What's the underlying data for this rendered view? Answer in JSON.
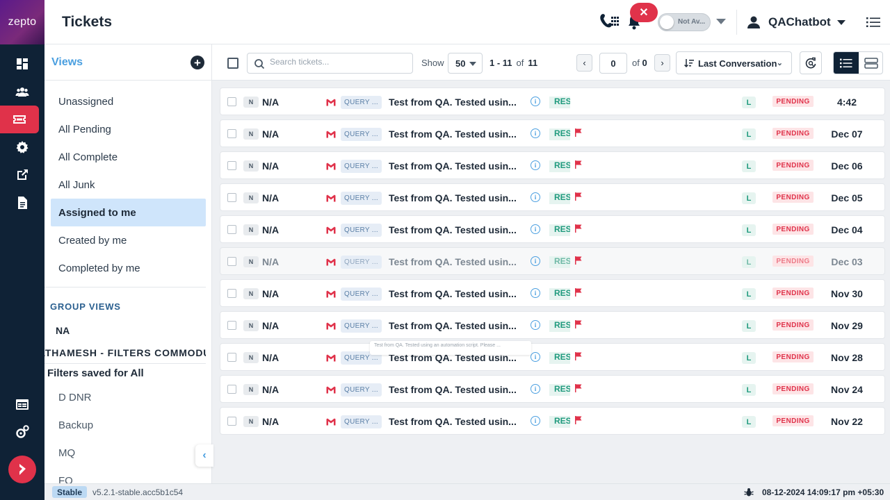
{
  "brand": {
    "logo_text": "zepto"
  },
  "rail": {
    "items": [
      {
        "name": "dashboard-icon"
      },
      {
        "name": "users-icon"
      },
      {
        "name": "tickets-icon",
        "active": true
      },
      {
        "name": "settings-icon"
      },
      {
        "name": "external-link-icon"
      },
      {
        "name": "document-icon"
      }
    ],
    "bottom_items": [
      {
        "name": "calendar-icon"
      },
      {
        "name": "config-icon"
      }
    ]
  },
  "header": {
    "title": "Tickets",
    "availability": "Not Av...",
    "user_name": "QAChatbot",
    "close_label": "✕"
  },
  "views": {
    "title": "Views",
    "items": [
      {
        "label": "Unassigned",
        "active": false
      },
      {
        "label": "All Pending",
        "active": false
      },
      {
        "label": "All Complete",
        "active": false
      },
      {
        "label": "All Junk",
        "active": false
      },
      {
        "label": "Assigned to me",
        "active": true
      },
      {
        "label": "Created by me",
        "active": false
      },
      {
        "label": "Completed by me",
        "active": false
      }
    ],
    "group_views_title": "GROUP VIEWS",
    "group_na": "NA",
    "group_filter": "PRATHAMESH - FILTERS COMMODUI",
    "filters_saved_title": "Filters saved for All",
    "filters_saved": [
      "D DNR",
      "Backup",
      "MQ",
      "FQ"
    ]
  },
  "toolbar": {
    "search_placeholder": "Search tickets...",
    "show_label": "Show",
    "page_size": "50",
    "range": "1 - 11",
    "of_label": "of",
    "total": "11",
    "page_input": "0",
    "page_of": "of",
    "page_total": "0",
    "sort_label": "Last Conversation"
  },
  "tickets": [
    {
      "n": "N",
      "requester": "N/A",
      "type": "QUERY ...",
      "subject": "Test from QA. Tested usin...",
      "status_short": "RES",
      "flag": false,
      "priority": "L",
      "state": "PENDING",
      "date": "4:42",
      "dim": false
    },
    {
      "n": "N",
      "requester": "N/A",
      "type": "QUERY ...",
      "subject": "Test from QA. Tested usin...",
      "status_short": "RES",
      "flag": true,
      "priority": "L",
      "state": "PENDING",
      "date": "Dec 07",
      "dim": false
    },
    {
      "n": "N",
      "requester": "N/A",
      "type": "QUERY ...",
      "subject": "Test from QA. Tested usin...",
      "status_short": "RES",
      "flag": true,
      "priority": "L",
      "state": "PENDING",
      "date": "Dec 06",
      "dim": false
    },
    {
      "n": "N",
      "requester": "N/A",
      "type": "QUERY ...",
      "subject": "Test from QA. Tested usin...",
      "status_short": "RES",
      "flag": true,
      "priority": "L",
      "state": "PENDING",
      "date": "Dec 05",
      "dim": false
    },
    {
      "n": "N",
      "requester": "N/A",
      "type": "QUERY ...",
      "subject": "Test from QA. Tested usin...",
      "status_short": "RES",
      "flag": true,
      "priority": "L",
      "state": "PENDING",
      "date": "Dec 04",
      "dim": false
    },
    {
      "n": "N",
      "requester": "N/A",
      "type": "QUERY ...",
      "subject": "Test from QA. Tested usin...",
      "status_short": "RES",
      "flag": true,
      "priority": "L",
      "state": "PENDING",
      "date": "Dec 03",
      "dim": true
    },
    {
      "n": "N",
      "requester": "N/A",
      "type": "QUERY ...",
      "subject": "Test from QA. Tested usin...",
      "status_short": "RES",
      "flag": true,
      "priority": "L",
      "state": "PENDING",
      "date": "Nov 30",
      "dim": false
    },
    {
      "n": "N",
      "requester": "N/A",
      "type": "QUERY ...",
      "subject": "Test from QA. Tested usin...",
      "status_short": "RES",
      "flag": true,
      "priority": "L",
      "state": "PENDING",
      "date": "Nov 29",
      "dim": false
    },
    {
      "n": "N",
      "requester": "N/A",
      "type": "QUERY ...",
      "subject": "Test from QA. Tested usin...",
      "status_short": "RES",
      "flag": true,
      "priority": "L",
      "state": "PENDING",
      "date": "Nov 28",
      "dim": false
    },
    {
      "n": "N",
      "requester": "N/A",
      "type": "QUERY ...",
      "subject": "Test from QA. Tested usin...",
      "status_short": "RES",
      "flag": true,
      "priority": "L",
      "state": "PENDING",
      "date": "Nov 24",
      "dim": false
    },
    {
      "n": "N",
      "requester": "N/A",
      "type": "QUERY ...",
      "subject": "Test from QA. Tested usin...",
      "status_short": "RES",
      "flag": true,
      "priority": "L",
      "state": "PENDING",
      "date": "Nov 22",
      "dim": false
    }
  ],
  "tooltip": "Test from QA. Tested using an automation script. Please ...",
  "footer": {
    "badge": "Stable",
    "version": "v5.2.1-stable.acc5b1c54",
    "timestamp": "08-12-2024 14:09:17 pm +05:30"
  },
  "colors": {
    "rail_bg": "#0f2236",
    "accent_red": "#e0324a",
    "views_blue": "#4a9fe0",
    "active_view_bg": "#cfe5fb",
    "res_green": "#1f9a7d",
    "pending_bg": "#fde4e6"
  }
}
